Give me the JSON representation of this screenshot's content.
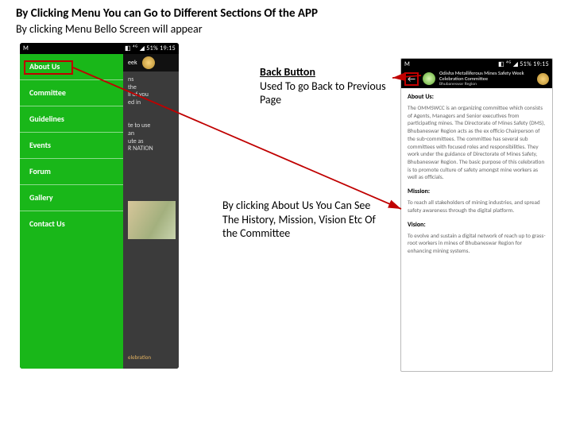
{
  "heading": {
    "line1": "By Clicking Menu You can Go to Different Sections Of the APP",
    "line2": "By clicking Menu Bello Screen will appear"
  },
  "status": {
    "left": "M",
    "right": "◧ ⁴ᴳ ◢ 51% 19:15"
  },
  "appbar": {
    "title": "eek",
    "subtitle": ""
  },
  "drawer": {
    "items": [
      {
        "label": "About Us"
      },
      {
        "label": "Committee"
      },
      {
        "label": "Guidelines"
      },
      {
        "label": "Events"
      },
      {
        "label": "Forum"
      },
      {
        "label": "Gallery"
      },
      {
        "label": "Contact Us"
      }
    ]
  },
  "peek": {
    "block1": "ns\nthe\nll of you\ned in",
    "block2": "te to use\nan\nute as\nR NATION",
    "footer": "elebration"
  },
  "note_back": {
    "title": "Back Button",
    "text": "Used To go Back to Previous Page"
  },
  "note_about": {
    "text": "By clicking About Us You Can See The History, Mission, Vision Etc Of the Committee"
  },
  "right": {
    "back_glyph": "←",
    "title": "Odisha Metalliferous Mines Safety Week\nCelebration Committee",
    "subtitle": "Bhubaneswar Region",
    "sections": {
      "about_h": "About Us:",
      "about_p": "The OMMSWCC is an organizing committee which consists of Agents, Managers and Senior executives from participating mines. The Directorate of Mines Safety (DMS), Bhubaneswar Region acts as the ex officio Chairperson of the sub-committees. The committee has several sub committees with focused roles and responsibilities. They work under the guidance of Directorate of Mines Safety, Bhubaneswar Region. The basic purpose of this celebration is to promote culture of safety amongst mine workers as well as officials.",
      "mission_h": "Mission:",
      "mission_p": "To reach all stakeholders of mining industries, and spread safety awareness through the digital platform.",
      "vision_h": "Vision:",
      "vision_p": "To evolve and sustain a digital network of reach up to grass-root workers in mines of Bhubaneswar Region for enhancing mining systems."
    }
  }
}
